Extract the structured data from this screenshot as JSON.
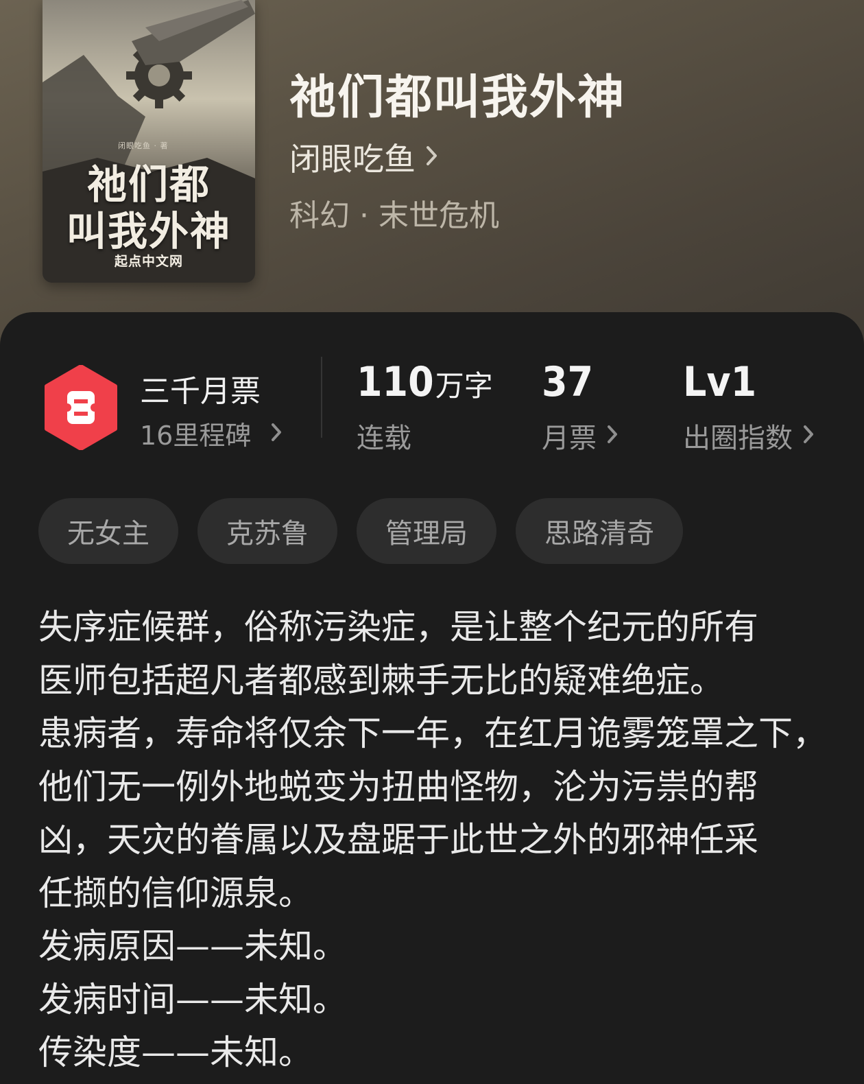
{
  "book": {
    "title": "祂们都叫我外神",
    "author": "闭眼吃鱼",
    "genre": "科幻 · 末世危机",
    "cover": {
      "small_author": "闭眼吃鱼 · 著",
      "title_line1": "祂们都",
      "title_line2": "叫我外神",
      "brand": "起点中文网"
    }
  },
  "stats": {
    "monthly_rank": {
      "title": "三千月票",
      "subtitle": "16里程碑"
    },
    "word_count": {
      "value": "110",
      "unit": "万字",
      "label": "连载"
    },
    "monthly_tickets": {
      "value": "37",
      "label": "月票"
    },
    "breakout_index": {
      "value": "Lv1",
      "label": "出圈指数"
    }
  },
  "tags": [
    "无女主",
    "克苏鲁",
    "管理局",
    "思路清奇"
  ],
  "description_lines": [
    "失序症候群，俗称污染症，是让整个纪元的所有",
    "医师包括超凡者都感到棘手无比的疑难绝症。",
    "患病者，寿命将仅余下一年，在红月诡雾笼罩之下，",
    "他们无一例外地蜕变为扭曲怪物，沦为污祟的帮",
    "凶，天灾的眷属以及盘踞于此世之外的邪神任采",
    "任撷的信仰源泉。",
    "发病原因——未知。",
    "发病时间——未知。",
    "传染度——未知。"
  ],
  "colors": {
    "header_bg": "#5a5244",
    "panel_bg": "#1c1c1c",
    "badge_red": "#f0404a",
    "tag_bg": "#2d2d2d"
  },
  "icons": {
    "badge": "ticket-badge-icon",
    "chevron": "chevron-right-icon"
  }
}
